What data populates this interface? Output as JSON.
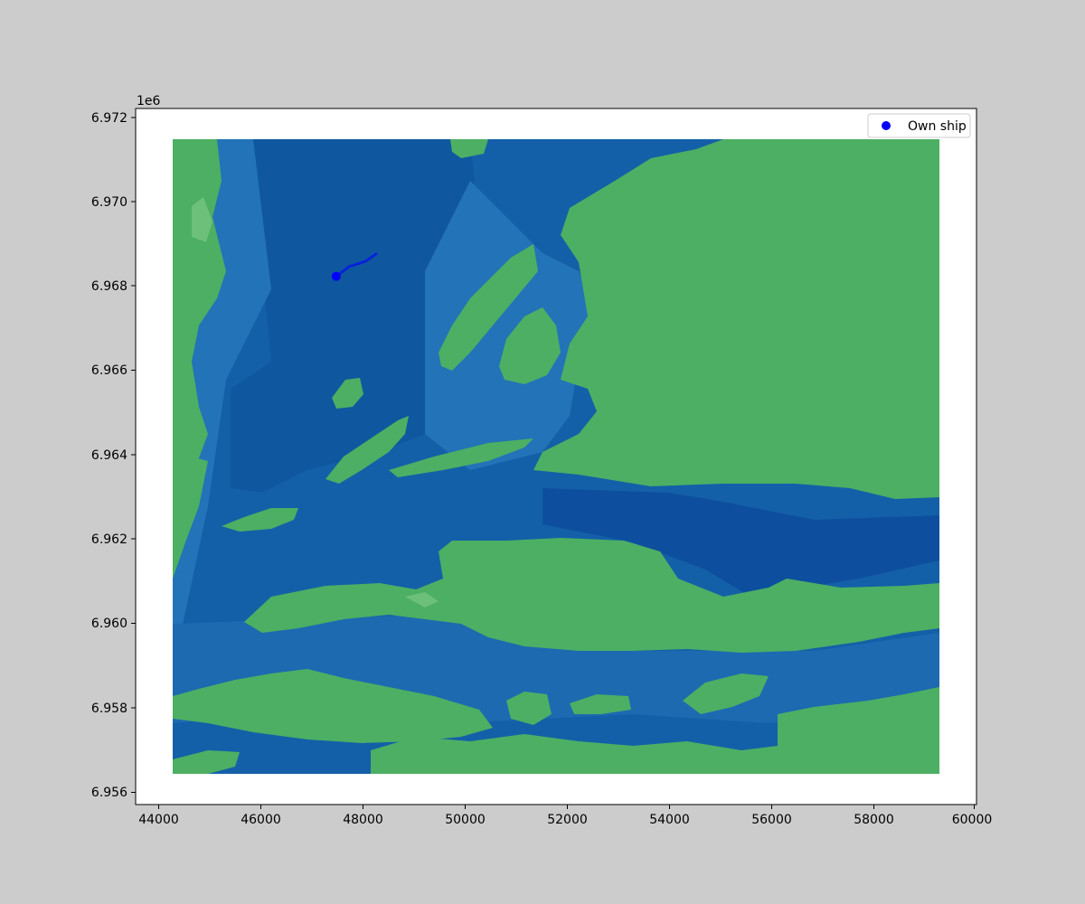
{
  "chart_data": {
    "type": "map",
    "title": "",
    "xlabel": "",
    "ylabel": "",
    "y_offset_label": "1e6",
    "xlim": [
      43580,
      60020
    ],
    "ylim": [
      6955680,
      6972180
    ],
    "x_ticks": [
      "44000",
      "46000",
      "48000",
      "50000",
      "52000",
      "54000",
      "56000",
      "58000",
      "60000"
    ],
    "y_ticks": [
      "6.956",
      "6.958",
      "6.960",
      "6.962",
      "6.964",
      "6.966",
      "6.968",
      "6.970",
      "6.972"
    ],
    "grid": false,
    "legend": {
      "placement": "top-right",
      "entries": [
        {
          "label": "Own ship",
          "color": "#0000ff",
          "marker": "circle"
        }
      ]
    },
    "own_ship": {
      "x": 47500,
      "y": 6968200
    },
    "track": [
      {
        "x": 47500,
        "y": 6968200
      },
      {
        "x": 47750,
        "y": 6968430
      },
      {
        "x": 48080,
        "y": 6968560
      },
      {
        "x": 48300,
        "y": 6968750
      }
    ],
    "map_extent": {
      "x": [
        44300,
        59300
      ],
      "y": [
        6956480,
        6971420
      ]
    }
  },
  "colors": {
    "figure_bg": "#cccccc",
    "axes_bg": "#ffffff",
    "land": "#4caf63",
    "land_light": "#6cc07a",
    "water_deep": "#0d4f9e",
    "water_mid": "#1460a8",
    "water_shallow": "#2373b8",
    "water_shelf": "#3d89c8",
    "ship": "#0000ff"
  }
}
